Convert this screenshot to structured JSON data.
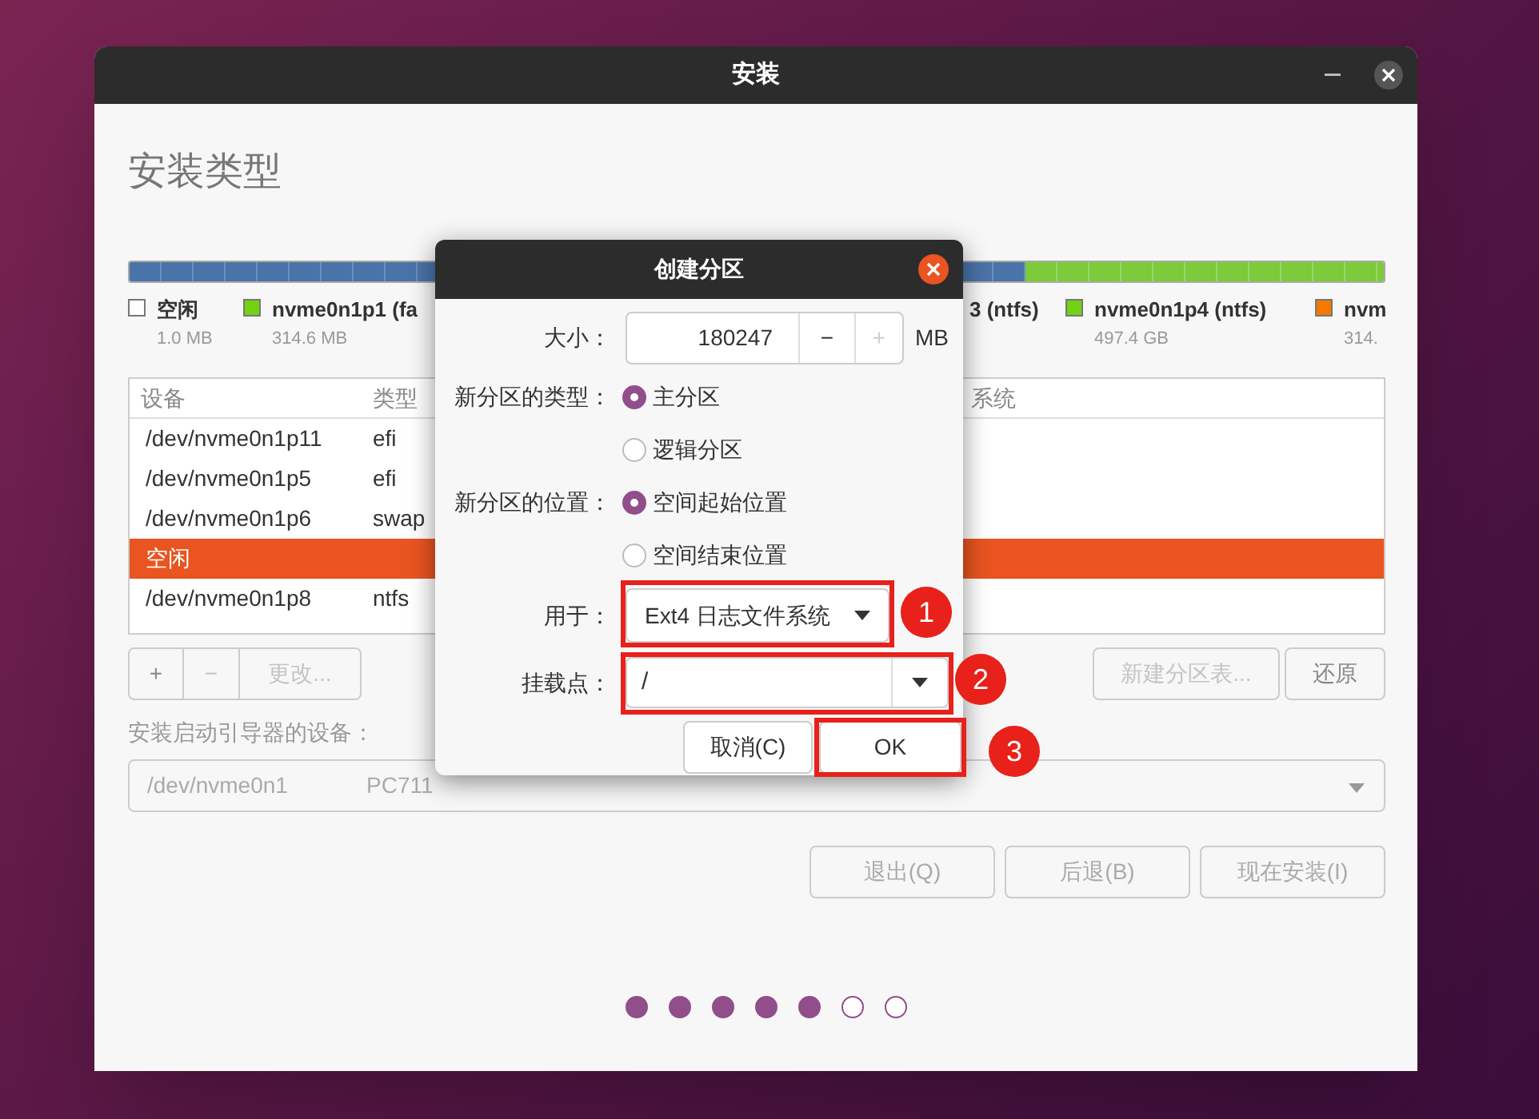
{
  "window": {
    "title": "安装"
  },
  "heading": "安装类型",
  "legend": [
    {
      "label": "空闲",
      "size": "1.0 MB",
      "color": "#ffffff"
    },
    {
      "label": "nvme0n1p1 (fa",
      "size": "314.6 MB",
      "color": "#73d216"
    },
    {
      "label": "3 (ntfs)"
    },
    {
      "label": "nvme0n1p4 (ntfs)",
      "size": "497.4 GB",
      "color": "#73d216"
    },
    {
      "label": "nvm",
      "size": "314.",
      "color": "#f57900"
    }
  ],
  "table": {
    "columns": [
      "设备",
      "类型",
      "系统"
    ],
    "rows": [
      {
        "device": "/dev/nvme0n1p11",
        "type": "efi",
        "selected": false
      },
      {
        "device": "/dev/nvme0n1p5",
        "type": "efi",
        "selected": false
      },
      {
        "device": "/dev/nvme0n1p6",
        "type": "swap",
        "selected": false
      },
      {
        "device": "空闲",
        "type": "",
        "selected": true
      },
      {
        "device": "/dev/nvme0n1p8",
        "type": "ntfs",
        "selected": false
      }
    ]
  },
  "table_buttons": [
    {
      "label": "+",
      "disabled": false
    },
    {
      "label": "−",
      "disabled": true
    },
    {
      "label": "更改...",
      "disabled": true
    }
  ],
  "table_buttons_right": [
    {
      "label": "新建分区表...",
      "disabled": true
    },
    {
      "label": "还原",
      "disabled": false
    }
  ],
  "bootloader": {
    "label": "安装启动引导器的设备：",
    "device": "/dev/nvme0n1",
    "model": "PC711"
  },
  "nav_buttons": [
    {
      "label": "退出(Q)",
      "disabled": true
    },
    {
      "label": "后退(B)",
      "disabled": true
    },
    {
      "label": "现在安装(I)",
      "disabled": true
    }
  ],
  "progress_dots": [
    {
      "filled": true
    },
    {
      "filled": true
    },
    {
      "filled": true
    },
    {
      "filled": true
    },
    {
      "filled": true
    },
    {
      "filled": false
    },
    {
      "filled": false
    }
  ],
  "dialog": {
    "title": "创建分区",
    "size": {
      "label": "大小：",
      "value": "180247",
      "minus": "−",
      "plus": "+",
      "unit": "MB",
      "plus_disabled": true
    },
    "type": {
      "label": "新分区的类型：",
      "options": [
        {
          "label": "主分区",
          "selected": true
        },
        {
          "label": "逻辑分区",
          "selected": false
        }
      ]
    },
    "location": {
      "label": "新分区的位置：",
      "options": [
        {
          "label": "空间起始位置",
          "selected": true
        },
        {
          "label": "空间结束位置",
          "selected": false
        }
      ]
    },
    "use_as": {
      "label": "用于：",
      "value": "Ext4 日志文件系统"
    },
    "mount_point": {
      "label": "挂载点：",
      "value": "/"
    },
    "buttons": [
      {
        "label": "取消(C)"
      },
      {
        "label": "OK"
      }
    ]
  },
  "annotations": [
    {
      "number": "1"
    },
    {
      "number": "2"
    },
    {
      "number": "3"
    }
  ]
}
